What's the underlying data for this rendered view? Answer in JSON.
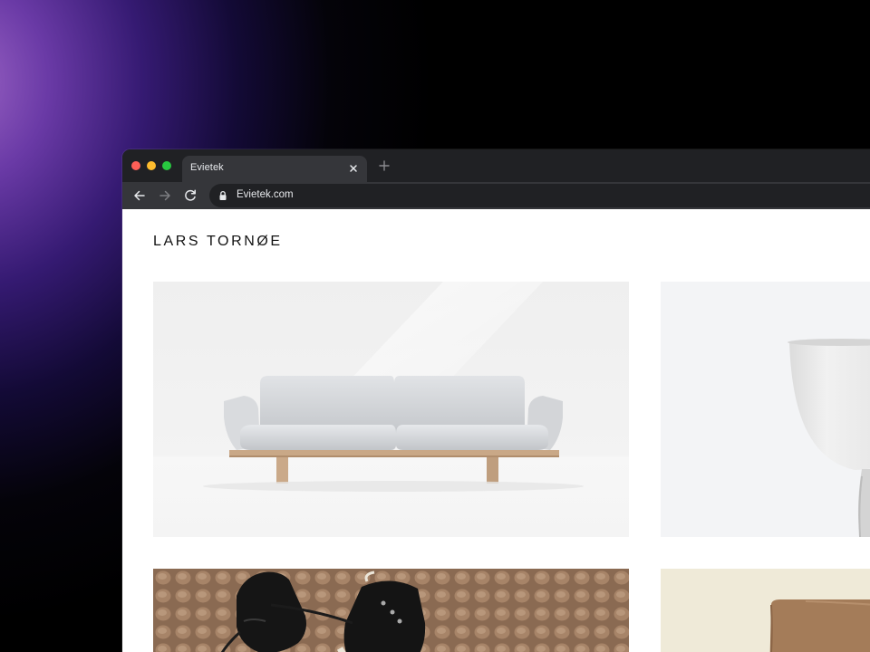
{
  "browser": {
    "tab": {
      "title": "Evietek"
    },
    "address_bar": {
      "url": "Evietek.com"
    }
  },
  "site": {
    "logo": "LARS TORNØE"
  },
  "colors": {
    "page_background": "#ffffff",
    "browser_chrome": "#202124",
    "toolbar": "#35363a",
    "accent_purple": "#6a3aa6"
  },
  "gallery": {
    "tiles": [
      {
        "name": "sofa-product-image",
        "icon": "sofa-photo"
      },
      {
        "name": "vase-product-image",
        "icon": "vase-photo"
      },
      {
        "name": "sneakers-product-image",
        "icon": "sneakers-photo"
      },
      {
        "name": "leather-chair-product-image",
        "icon": "leather-photo"
      }
    ]
  }
}
